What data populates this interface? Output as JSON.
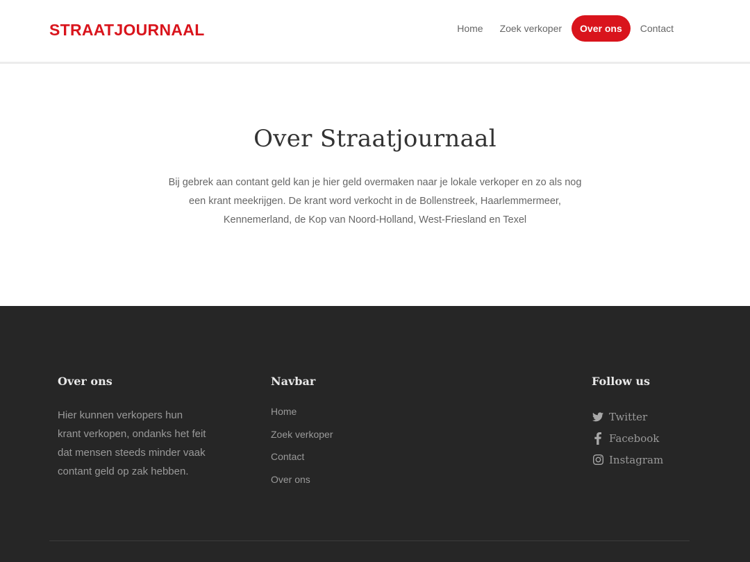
{
  "brand": {
    "name": "STRAATJOURNAAL",
    "color": "#d9141c"
  },
  "nav": {
    "items": [
      {
        "label": "Home",
        "active": false
      },
      {
        "label": "Zoek verkoper",
        "active": false
      },
      {
        "label": "Over ons",
        "active": true
      },
      {
        "label": "Contact",
        "active": false
      }
    ]
  },
  "hero": {
    "title": "Over Straatjournaal",
    "text": "Bij gebrek aan contant geld kan je hier geld overmaken naar je lokale verkoper en zo als nog een krant meekrijgen. De krant word verkocht in de Bollenstreek, Haarlemmermeer, Kennemerland, de Kop van Noord-Holland, West-Friesland en Texel"
  },
  "footer": {
    "about": {
      "title": "Over ons",
      "text": "Hier kunnen verkopers hun krant verkopen, ondanks het feit dat mensen steeds minder vaak contant geld op zak hebben."
    },
    "navbar": {
      "title": "Navbar",
      "links": [
        "Home",
        "Zoek verkoper",
        "Contact",
        "Over ons"
      ]
    },
    "follow": {
      "title": "Follow us",
      "items": [
        {
          "label": "Twitter",
          "icon": "twitter-icon"
        },
        {
          "label": "Facebook",
          "icon": "facebook-icon"
        },
        {
          "label": "Instagram",
          "icon": "instagram-icon"
        }
      ]
    }
  },
  "colors": {
    "accent": "#d9141c",
    "footer_bg": "#262626"
  }
}
